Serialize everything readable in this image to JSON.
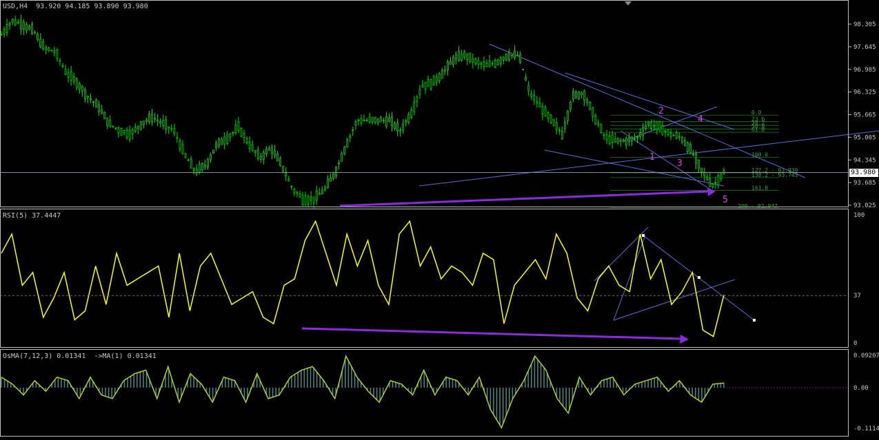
{
  "colors": {
    "background": "#000000",
    "frame": "#c0c0c0",
    "candles": "#00e000",
    "rsi_line": "#ffff00",
    "osma_hist": "#4f7f7f",
    "osma_signal": "#b0d030",
    "trendlines": "#5a6be0",
    "wave_labels": "#e040e0",
    "fibo": "#1c7a1c",
    "arrows": "#8a2be2",
    "price_line": "#8fa3b8"
  },
  "main": {
    "header": "USD,H4  93.920 94.185 93.890 93.980",
    "current_price_label": "93.980",
    "y_ticks": [
      "98.305",
      "97.645",
      "96.985",
      "96.325",
      "95.665",
      "95.005",
      "94.345",
      "93.685",
      "93.025"
    ],
    "wave_labels": [
      "1",
      "2",
      "3",
      "4",
      "5"
    ],
    "fibo_labels": [
      {
        "text": "0.0",
        "level": 95.65
      },
      {
        "text": "23.6",
        "level": 95.46
      },
      {
        "text": "38.2",
        "level": 95.35
      },
      {
        "text": "50.0",
        "level": 95.25
      },
      {
        "text": "61.8",
        "level": 95.15
      },
      {
        "text": "100.0",
        "level": 94.42
      },
      {
        "text": "127.2 - 93.939",
        "level": 93.97
      },
      {
        "text": "138.2 - 93.743",
        "level": 93.83
      },
      {
        "text": "161.8",
        "level": 93.46
      },
      {
        "text": "200 - 92.947",
        "level": 92.96
      }
    ]
  },
  "rsi": {
    "header": "RSI(5) 37.4447",
    "y_ticks": [
      "100",
      "37",
      "0"
    ],
    "level": 37
  },
  "osma": {
    "header": "OsMA(7,12,3) 0.01341  ->MA(1) 0.01341",
    "y_ticks": [
      "0.09207",
      "0.00",
      "-0.1114"
    ]
  },
  "chart_data": {
    "type": "line",
    "title": "USD,H4",
    "symbol": "USD",
    "timeframe": "H4",
    "last_bar": {
      "open": 93.92,
      "high": 94.185,
      "low": 93.89,
      "close": 93.98
    },
    "price_ylim": [
      93.0,
      98.6
    ],
    "price_series": [
      98.0,
      98.4,
      98.3,
      98.1,
      97.6,
      97.5,
      96.9,
      96.6,
      96.2,
      95.9,
      95.4,
      95.2,
      95.1,
      95.4,
      95.6,
      95.4,
      95.2,
      94.5,
      94.0,
      94.2,
      94.8,
      95.0,
      95.3,
      94.8,
      94.4,
      94.7,
      94.2,
      93.5,
      93.2,
      93.2,
      93.5,
      94.0,
      94.8,
      95.5,
      95.5,
      95.5,
      95.5,
      95.2,
      95.7,
      96.5,
      96.6,
      96.9,
      97.3,
      97.4,
      97.2,
      97.1,
      97.2,
      97.4,
      97.4,
      96.3,
      95.9,
      95.5,
      95.1,
      96.2,
      96.3,
      95.6,
      95.0,
      94.9,
      94.9,
      95.0,
      95.4,
      95.3,
      95.1,
      95.0,
      94.6,
      94.0,
      93.6,
      93.98
    ],
    "rsi_series": [
      70,
      85,
      45,
      55,
      20,
      35,
      55,
      18,
      25,
      60,
      30,
      70,
      45,
      50,
      55,
      60,
      20,
      70,
      25,
      60,
      70,
      50,
      30,
      35,
      40,
      20,
      15,
      45,
      50,
      80,
      95,
      70,
      45,
      85,
      60,
      80,
      45,
      30,
      85,
      95,
      60,
      75,
      50,
      60,
      55,
      45,
      70,
      65,
      15,
      45,
      55,
      65,
      50,
      85,
      70,
      35,
      25,
      50,
      60,
      45,
      40,
      85,
      50,
      65,
      30,
      40,
      55,
      10,
      5,
      37.44
    ],
    "osma_series": [
      0.03,
      0.01,
      -0.02,
      0.02,
      -0.01,
      0.03,
      0.02,
      -0.03,
      0.03,
      -0.02,
      -0.03,
      0.02,
      0.04,
      0.05,
      -0.03,
      0.06,
      -0.04,
      0.04,
      0.01,
      -0.04,
      0.03,
      0.02,
      -0.04,
      0.04,
      -0.03,
      -0.02,
      0.03,
      0.05,
      0.06,
      0.02,
      -0.03,
      0.09,
      0.03,
      -0.01,
      -0.04,
      0.02,
      0.01,
      -0.02,
      0.05,
      -0.02,
      0.03,
      0.02,
      -0.02,
      0.03,
      -0.06,
      -0.11,
      -0.03,
      0.02,
      0.09,
      0.05,
      -0.03,
      -0.07,
      0.03,
      -0.02,
      0.02,
      0.03,
      -0.02,
      0.01,
      0.02,
      0.03,
      -0.01,
      0.02,
      -0.02,
      -0.04,
      0.01,
      0.0134
    ],
    "rsi_ylim": [
      0,
      100
    ],
    "osma_ylim": [
      -0.1114,
      0.09207
    ]
  }
}
